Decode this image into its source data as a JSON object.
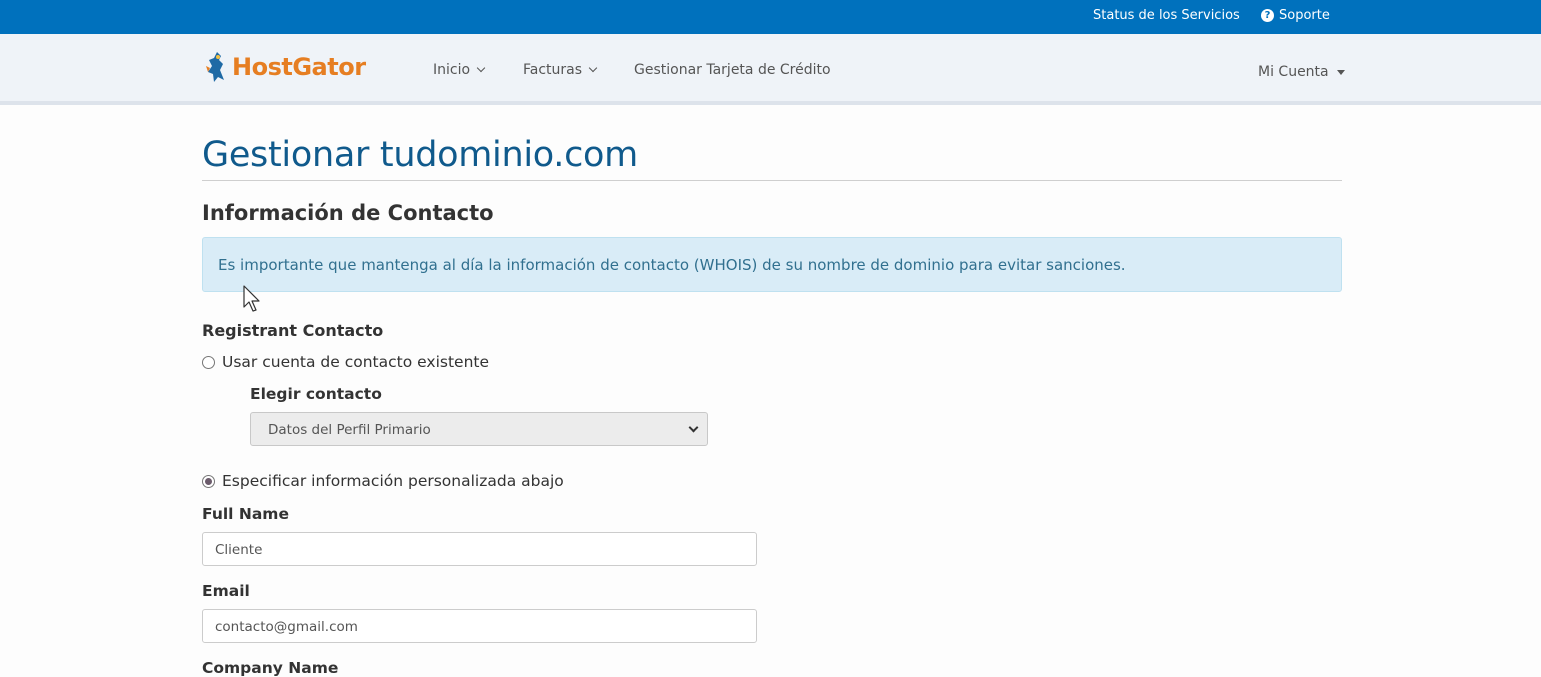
{
  "topbar": {
    "status_label": "Status de los Servicios",
    "support_label": "Soporte"
  },
  "navbar": {
    "logo_text": "HostGator",
    "items": [
      {
        "label": "Inicio"
      },
      {
        "label": "Facturas"
      },
      {
        "label": "Gestionar Tarjeta de Crédito"
      }
    ],
    "account_label": "Mi Cuenta"
  },
  "main": {
    "title": "Gestionar tudominio.com",
    "section_title": "Información de Contacto",
    "alert_text": "Es importante que mantenga al día la información de contacto (WHOIS) de su nombre de dominio para evitar sanciones.",
    "registrant_heading": "Registrant Contacto",
    "radio_existing_label": "Usar cuenta de contacto existente",
    "choose_contact_label": "Elegir contacto",
    "choose_contact_value": "Datos del Perfil Primario",
    "radio_custom_label": "Especificar información personalizada abajo",
    "full_name_label": "Full Name",
    "full_name_value": "Cliente",
    "email_label": "Email",
    "email_value": "contacto@gmail.com",
    "company_label": "Company Name"
  },
  "colors": {
    "topbar": "#0071bd",
    "title": "#105a8c",
    "logo": "#e67e22",
    "alert_bg": "#d9ecf7"
  }
}
